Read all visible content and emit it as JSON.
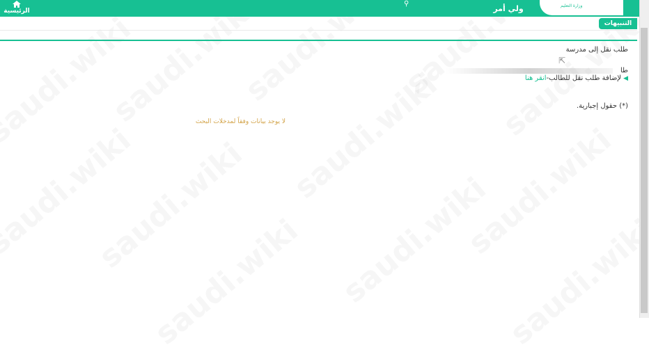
{
  "header": {
    "home_label": "الرئيسية",
    "user_role": "ولي أمر",
    "logo_text": "وزارة التعليم"
  },
  "tabs": {
    "alerts": "التنبيهات"
  },
  "main": {
    "title": "طلب نقل إلى مدرسة",
    "student_prefix": "طا",
    "add_text": "لإضافة طلب نقل للطالب",
    "add_link": "انقر هنا",
    "required_note": "(*) حقول إجبارية.",
    "no_data": "لا يوجد بيانات وفقاً لمدخلات البحث"
  },
  "watermark": "saudi.wiki",
  "colors": {
    "accent": "#17c093",
    "warning_text": "#d3a44a"
  }
}
